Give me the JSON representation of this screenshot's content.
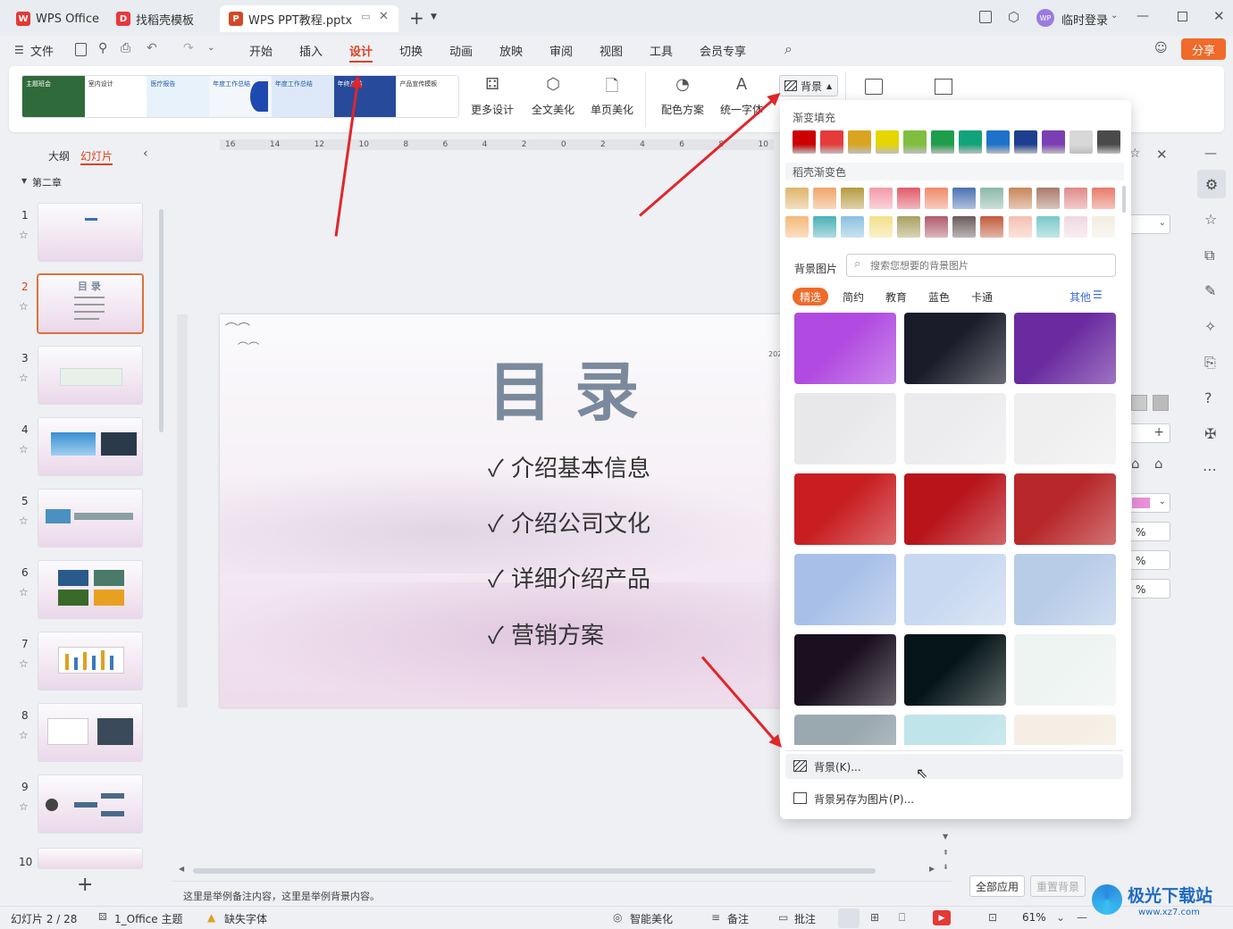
{
  "tabs": [
    {
      "label": "WPS Office"
    },
    {
      "label": "找稻壳模板"
    },
    {
      "label": "WPS PPT教程.pptx"
    }
  ],
  "user": {
    "avatar": "WP",
    "login": "临时登录"
  },
  "menu": [
    "文件",
    "开始",
    "插入",
    "设计",
    "切换",
    "动画",
    "放映",
    "审阅",
    "视图",
    "工具",
    "会员专享"
  ],
  "share_label": "分享",
  "ribbon": {
    "more_design": "更多设计",
    "full_beautify": "全文美化",
    "single_beautify": "单页美化",
    "color_scheme": "配色方案",
    "unify_font": "统一字体",
    "background": "背景"
  },
  "templates": [
    {
      "bg": "#2f6b3a",
      "t": "主题班会"
    },
    {
      "bg": "#ffffff",
      "t": "室内设计"
    },
    {
      "bg": "#e8f2fa",
      "t": "医疗报告"
    },
    {
      "bg": "#f3f6fb",
      "t": "年度工作总结"
    },
    {
      "bg": "#dde9f8",
      "t": "年度工作总结"
    },
    {
      "bg": "#274a9b",
      "t": "年终总结"
    },
    {
      "bg": "#ffffff",
      "t": "产品宣传模板"
    }
  ],
  "left": {
    "tab_outline": "大纲",
    "tab_slides": "幻灯片",
    "section": "第二章",
    "nums": [
      "1",
      "2",
      "3",
      "4",
      "5",
      "6",
      "7",
      "8",
      "9",
      "10"
    ],
    "slide2_title": "目 录"
  },
  "slide": {
    "title": "目 录",
    "items": [
      "介绍基本信息",
      "介绍公司文化",
      "详细介绍产品",
      "营销方案"
    ],
    "check": "✓",
    "date": "202"
  },
  "ruler": [
    "16",
    "14",
    "12",
    "10",
    "8",
    "6",
    "4",
    "2",
    "0",
    "2",
    "4",
    "6",
    "8",
    "10"
  ],
  "popup": {
    "gradient_fill": "渐变填充",
    "solid": [
      "#cc0000",
      "#e63b3b",
      "#d9a520",
      "#e6d500",
      "#7fbf3f",
      "#1e9e4a",
      "#13a37a",
      "#1e72c9",
      "#1e3f8f",
      "#7a3fb3",
      "#d8d8d8",
      "#4a4a4a"
    ],
    "daoke_gradient": "稻壳渐变色",
    "grad_row1": [
      "#e0b56d",
      "#f0a56a",
      "#b59a3e",
      "#f39aa8",
      "#e05a6a",
      "#f08a6a",
      "#4a72b0",
      "#8ab8a8",
      "#c8865a",
      "#a87a6a",
      "#e08a8a",
      "#e87a6a"
    ],
    "grad_row2": [
      "#f5b87a",
      "#4ab0b8",
      "#8ac0e0",
      "#f2e08a",
      "#a8a060",
      "#b05a6a",
      "#6a5a5a",
      "#c05a3a",
      "#f5c0b0",
      "#7ac8c8",
      "#f0d8e0",
      "#f2ede0"
    ],
    "bg_picture": "背景图片",
    "search_placeholder": "搜索您想要的背景图片",
    "categories": [
      "精选",
      "简约",
      "教育",
      "蓝色",
      "卡通"
    ],
    "other": "其他",
    "images": [
      "#b04ae0",
      "#1a1c2a",
      "#6a2aa0",
      "#e8e8ea",
      "#ececee",
      "#efefef",
      "#c81e22",
      "#b8141a",
      "#b8282a",
      "#a8c0e8",
      "#c8d8f0",
      "#b8cce8",
      "#1a1020",
      "#061618",
      "#eef4f2",
      "#9aa8b0",
      "#bfe4ea",
      "#f6eee4"
    ],
    "bg_menu": "背景(K)...",
    "save_bg": "背景另存为图片(P)..."
  },
  "right": {
    "apply_all": "全部应用",
    "reset_bg": "重置背景",
    "pct": "%"
  },
  "notes": "这里是举例备注内容，这里是举例背景内容。",
  "status": {
    "slide_info": "幻灯片 2 / 28",
    "theme": "1_Office 主题",
    "missing_font": "缺失字体",
    "smart": "智能美化",
    "notes": "备注",
    "comment": "批注",
    "zoom": "61%"
  },
  "watermark": {
    "title": "极光下载站",
    "url": "www.xz7.com"
  },
  "accent": "#e0401e"
}
